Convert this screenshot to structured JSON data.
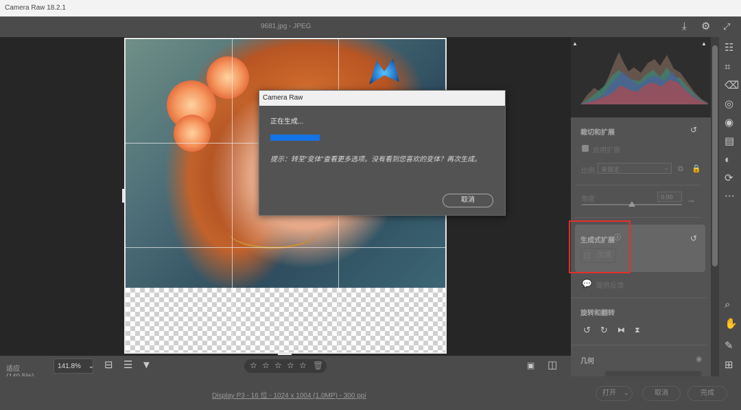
{
  "app": {
    "title": "Camera Raw 18.2.1",
    "file_info": "9681.jpg - JPEG"
  },
  "zoom": {
    "fit_label": "适应 (140.5%)",
    "current": "141.8%"
  },
  "status": {
    "image_info": "Display P3 - 16 位 - 1024 x 1004 (1.0MP) - 300 ppi"
  },
  "footer": {
    "open_label": "打开",
    "cancel_label": "取消",
    "done_label": "完成"
  },
  "dialog": {
    "title": "Camera Raw",
    "message": "正在生成...",
    "progress_fraction": 0.2,
    "tip": "提示：转至\"变体\"查看更多选项。没有看到您喜欢的变体？再次生成。",
    "cancel_label": "取消"
  },
  "panel": {
    "crop_title": "裁切和扩展",
    "enable_expand": "启用扩展",
    "aspect_label": "比例",
    "aspect_value": "未锁定",
    "angle_label": "角度",
    "angle_value": "0.00",
    "gen_expand_title": "生成式扩展",
    "generate_label": "生成",
    "feedback_label": "提供反馈",
    "rotate_title": "旋转和翻转",
    "geometry_title": "几何"
  },
  "colors": {
    "accent": "#1473e6",
    "highlight": "#e3302a"
  },
  "icons": [
    "save-icon",
    "settings-icon",
    "fullscreen-icon",
    "edit-icon",
    "crop-icon",
    "eraser-icon",
    "mask-icon",
    "redeye-icon",
    "snapshot-icon",
    "presets-icon",
    "sync-icon",
    "more-icon",
    "zoom-icon",
    "hand-icon",
    "eyedropper-icon",
    "grid-icon"
  ]
}
